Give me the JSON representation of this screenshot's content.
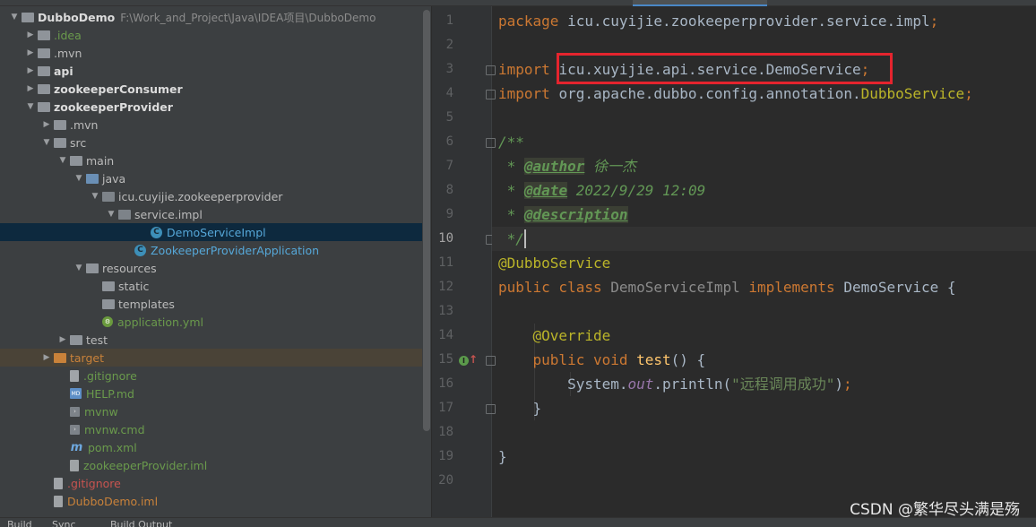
{
  "project_tree": [
    {
      "label": "DubboDemo",
      "path": "F:\\Work_and_Project\\Java\\IDEA项目\\DubboDemo",
      "depth": 0,
      "arrow": "down",
      "icon": "folder-icon",
      "style": "bold"
    },
    {
      "label": ".idea",
      "depth": 1,
      "arrow": "right",
      "icon": "folder-icon",
      "style": "green"
    },
    {
      "label": ".mvn",
      "depth": 1,
      "arrow": "right",
      "icon": "folder-icon",
      "style": "normal"
    },
    {
      "label": "api",
      "depth": 1,
      "arrow": "right",
      "icon": "module-folder-icon",
      "style": "bold"
    },
    {
      "label": "zookeeperConsumer",
      "depth": 1,
      "arrow": "right",
      "icon": "module-folder-icon",
      "style": "bold"
    },
    {
      "label": "zookeeperProvider",
      "depth": 1,
      "arrow": "down",
      "icon": "module-folder-icon",
      "style": "bold"
    },
    {
      "label": ".mvn",
      "depth": 2,
      "arrow": "right",
      "icon": "folder-icon",
      "style": "normal"
    },
    {
      "label": "src",
      "depth": 2,
      "arrow": "down",
      "icon": "folder-icon",
      "style": "normal"
    },
    {
      "label": "main",
      "depth": 3,
      "arrow": "down",
      "icon": "folder-icon",
      "style": "normal"
    },
    {
      "label": "java",
      "depth": 4,
      "arrow": "down",
      "icon": "source-folder-icon",
      "style": "normal"
    },
    {
      "label": "icu.cuyijie.zookeeperprovider",
      "depth": 5,
      "arrow": "down",
      "icon": "package-icon",
      "style": "normal"
    },
    {
      "label": "service.impl",
      "depth": 6,
      "arrow": "down",
      "icon": "package-icon",
      "style": "normal"
    },
    {
      "label": "DemoServiceImpl",
      "depth": 8,
      "arrow": "",
      "icon": "class-icon",
      "style": "blue",
      "selected": true
    },
    {
      "label": "ZookeeperProviderApplication",
      "depth": 7,
      "arrow": "",
      "icon": "spring-class-icon",
      "style": "blue"
    },
    {
      "label": "resources",
      "depth": 4,
      "arrow": "down",
      "icon": "resources-folder-icon",
      "style": "normal"
    },
    {
      "label": "static",
      "depth": 5,
      "arrow": "",
      "icon": "folder-icon",
      "style": "normal"
    },
    {
      "label": "templates",
      "depth": 5,
      "arrow": "",
      "icon": "folder-icon",
      "style": "normal"
    },
    {
      "label": "application.yml",
      "depth": 5,
      "arrow": "",
      "icon": "yaml-file-icon",
      "style": "green"
    },
    {
      "label": "test",
      "depth": 3,
      "arrow": "right",
      "icon": "folder-icon",
      "style": "normal"
    },
    {
      "label": "target",
      "depth": 2,
      "arrow": "right",
      "icon": "excluded-folder-icon",
      "style": "excluded",
      "excluded": true
    },
    {
      "label": ".gitignore",
      "depth": 3,
      "arrow": "",
      "icon": "gitignore-file-icon",
      "style": "green"
    },
    {
      "label": "HELP.md",
      "depth": 3,
      "arrow": "",
      "icon": "markdown-file-icon",
      "style": "green"
    },
    {
      "label": "mvnw",
      "depth": 3,
      "arrow": "",
      "icon": "shell-file-icon",
      "style": "green"
    },
    {
      "label": "mvnw.cmd",
      "depth": 3,
      "arrow": "",
      "icon": "shell-file-icon",
      "style": "green"
    },
    {
      "label": "pom.xml",
      "depth": 3,
      "arrow": "",
      "icon": "maven-file-icon",
      "style": "green"
    },
    {
      "label": "zookeeperProvider.iml",
      "depth": 3,
      "arrow": "",
      "icon": "iml-file-icon",
      "style": "green"
    },
    {
      "label": ".gitignore",
      "depth": 2,
      "arrow": "",
      "icon": "gitignore-file-icon",
      "style": "red"
    },
    {
      "label": "DubboDemo.iml",
      "depth": 2,
      "arrow": "",
      "icon": "iml-file-icon",
      "style": "excl"
    }
  ],
  "editor": {
    "current_line": 10,
    "lines": [
      {
        "n": "1",
        "tokens": [
          [
            "kw",
            "package "
          ],
          [
            "cls",
            "icu.cuyijie.zookeeperprovider.service.impl"
          ],
          [
            "kw",
            ";"
          ]
        ]
      },
      {
        "n": "2",
        "tokens": []
      },
      {
        "n": "3",
        "tokens": [
          [
            "kw",
            "import "
          ],
          [
            "cls",
            "icu.xuyijie.api.service.DemoService"
          ],
          [
            "kw",
            ";"
          ]
        ],
        "fold": true
      },
      {
        "n": "4",
        "tokens": [
          [
            "kw",
            "import "
          ],
          [
            "cls",
            "org.apache.dubbo.config.annotation."
          ],
          [
            "ann",
            "DubboService"
          ],
          [
            "kw",
            ";"
          ]
        ],
        "fold": true
      },
      {
        "n": "5",
        "tokens": []
      },
      {
        "n": "6",
        "tokens": [
          [
            "doc",
            "/**"
          ]
        ],
        "fold": true
      },
      {
        "n": "7",
        "tokens": [
          [
            "doc",
            " * "
          ],
          [
            "doctag",
            "@author"
          ],
          [
            "doc",
            " 徐一杰"
          ]
        ]
      },
      {
        "n": "8",
        "tokens": [
          [
            "doc",
            " * "
          ],
          [
            "doctag",
            "@date"
          ],
          [
            "doc",
            " 2022/9/29 12:09"
          ]
        ]
      },
      {
        "n": "9",
        "tokens": [
          [
            "doc",
            " * "
          ],
          [
            "doctag",
            "@description"
          ]
        ]
      },
      {
        "n": "10",
        "tokens": [
          [
            "doc",
            " */"
          ]
        ],
        "fold": true
      },
      {
        "n": "11",
        "tokens": [
          [
            "ann",
            "@DubboService"
          ]
        ]
      },
      {
        "n": "12",
        "tokens": [
          [
            "kw",
            "public class "
          ],
          [
            "dimcls",
            "DemoServiceImpl "
          ],
          [
            "kw",
            "implements "
          ],
          [
            "cls",
            "DemoService {"
          ]
        ]
      },
      {
        "n": "13",
        "tokens": []
      },
      {
        "n": "14",
        "tokens": [
          [
            "ann",
            "    @Override"
          ]
        ]
      },
      {
        "n": "15",
        "tokens": [
          [
            "kw",
            "    public void "
          ],
          [
            "fn",
            "test"
          ],
          [
            "cls",
            "() {"
          ]
        ],
        "fold": true,
        "gutter_icon": "implements-method-icon"
      },
      {
        "n": "16",
        "tokens": [
          [
            "cls",
            "        System."
          ],
          [
            "field",
            "out"
          ],
          [
            "cls",
            ".println("
          ],
          [
            "str",
            "\"远程调用成功\""
          ],
          [
            "cls",
            ")"
          ],
          [
            "kw",
            ";"
          ]
        ]
      },
      {
        "n": "17",
        "tokens": [
          [
            "cls",
            "    }"
          ]
        ],
        "fold": true
      },
      {
        "n": "18",
        "tokens": []
      },
      {
        "n": "19",
        "tokens": [
          [
            "cls",
            "}"
          ]
        ]
      },
      {
        "n": "20",
        "tokens": []
      }
    ]
  },
  "bottom_tabs": [
    "Build",
    "Sync",
    "Build Output"
  ],
  "watermark": "CSDN @繁华尽头满是殇",
  "colors": {
    "keyword": "#cc7832",
    "annotation": "#bbb529",
    "doc_comment": "#629755",
    "string": "#6a8759",
    "highlight_box": "#e5242e",
    "selection": "#0d293e"
  }
}
